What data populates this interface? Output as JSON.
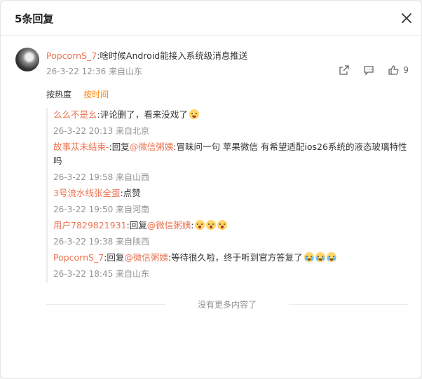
{
  "header": {
    "title": "5条回复"
  },
  "root": {
    "user": "PopcornS_7",
    "text": ":啥时候Android能接入系统级消息推送",
    "meta": "26-3-22 12:36 来自山东",
    "like_count": "9"
  },
  "sort": {
    "hot": "按热度",
    "time": "按时间"
  },
  "replies": [
    {
      "user": "么么不是幺",
      "text": ":评论删了，看来没戏了",
      "emoji": "doge",
      "meta": "26-3-22 20:13 来自北京"
    },
    {
      "user": "故事苁未结束-",
      "prefix": ":回复",
      "mention": "@微信粥姨",
      "text": ":冒昧问一句  苹果微信 有希望适配ios26系统的液态玻璃特性吗",
      "meta": "26-3-22 19:58 来自山西"
    },
    {
      "user": "3号流水线张全蛋",
      "text": ":点赞",
      "meta": "26-3-22 19:50 来自河南"
    },
    {
      "user": "用户7829821931",
      "prefix": ":回复",
      "mention": "@微信粥姨",
      "text": ":",
      "emoji": "wow x3",
      "meta": "26-3-22 19:38 来自陕西"
    },
    {
      "user": "PopcornS_7",
      "prefix": ":回复",
      "mention": "@微信粥姨",
      "text": ":等待很久啦，终于听到官方答复了",
      "emoji": "cry x3",
      "meta": "26-3-22 18:45 来自山东"
    }
  ],
  "footer": {
    "end_text": "没有更多内容了"
  },
  "colors": {
    "accent": "#ff8200",
    "username": "#eb7350",
    "meta": "#939393"
  }
}
